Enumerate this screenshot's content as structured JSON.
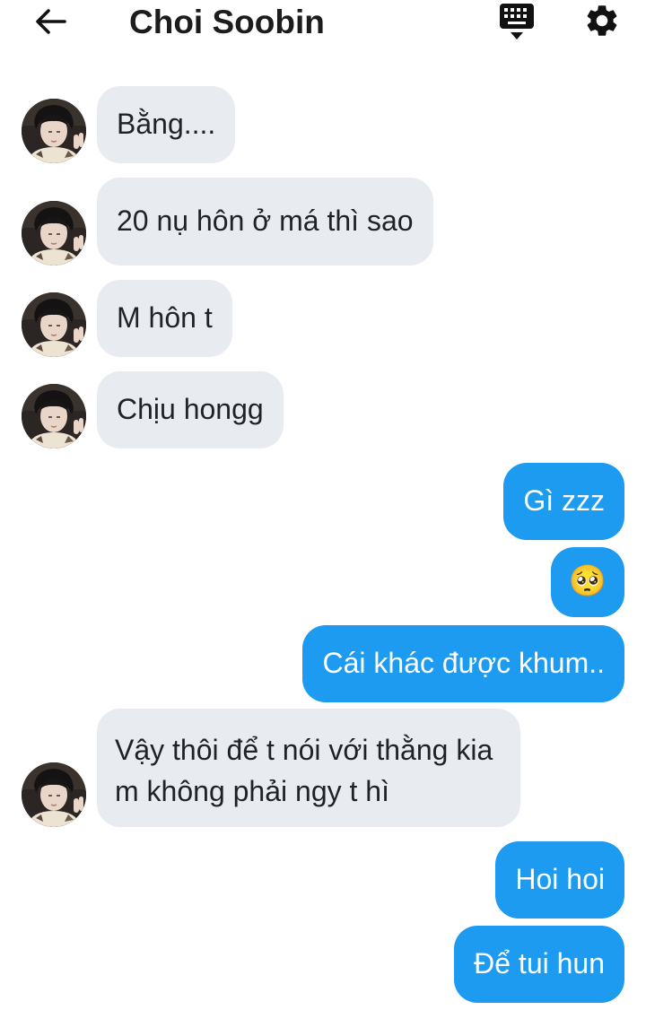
{
  "header": {
    "title": "Choi Soobin",
    "back_icon": "arrow-left-icon",
    "keyboard_icon": "keyboard-icon",
    "settings_icon": "gear-icon"
  },
  "colors": {
    "incoming_bubble": "#e8ebef",
    "outgoing_bubble": "#1d9bf0",
    "text": "#1f2328"
  },
  "messages": [
    {
      "direction": "in",
      "text": "Bằng...."
    },
    {
      "direction": "in",
      "text": "20 nụ hôn ở má thì sao"
    },
    {
      "direction": "in",
      "text": "M hôn t"
    },
    {
      "direction": "in",
      "text": "Chịu hongg"
    },
    {
      "direction": "out",
      "text": "Gì zzz"
    },
    {
      "direction": "out",
      "text": "🥺"
    },
    {
      "direction": "out",
      "text": "Cái khác được khum.."
    },
    {
      "direction": "in",
      "text": "Vậy thôi để t nói với thằng kia m không phải ngy t hì"
    },
    {
      "direction": "out",
      "text": "Hoi hoi"
    },
    {
      "direction": "out",
      "text": "Để tui hun"
    }
  ]
}
